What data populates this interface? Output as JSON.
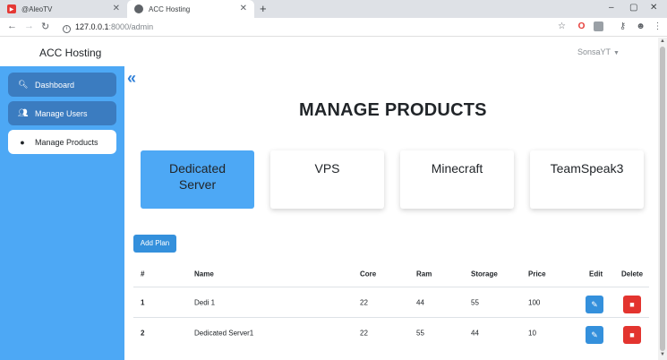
{
  "browser": {
    "tabs": [
      {
        "title": "@AleoTV",
        "icon": "youtube-studio-icon",
        "color": "#e53935"
      },
      {
        "title": "ACC Hosting",
        "icon": "globe-icon"
      }
    ],
    "url_host": "127.0.0.1",
    "url_path": ":8000/admin"
  },
  "navbar": {
    "brand": "ACC Hosting",
    "user": "SonsaYT"
  },
  "sidebar": {
    "items": [
      {
        "label": "Dashboard",
        "icon": "search-icon",
        "active": false
      },
      {
        "label": "Manage Users",
        "icon": "users-icon",
        "active": false
      },
      {
        "label": "Manage Products",
        "icon": "product-icon",
        "active": true
      }
    ]
  },
  "main": {
    "title": "MANAGE PRODUCTS",
    "categories": [
      {
        "label_line1": "Dedicated",
        "label_line2": "Server",
        "active": true
      },
      {
        "label_line1": "VPS",
        "label_line2": "",
        "active": false
      },
      {
        "label_line1": "Minecraft",
        "label_line2": "",
        "active": false
      },
      {
        "label_line1": "TeamSpeak3",
        "label_line2": "",
        "active": false
      }
    ],
    "add_button": "Add Plan",
    "table": {
      "headers": [
        "#",
        "Name",
        "Core",
        "Ram",
        "Storage",
        "Price",
        "Edit",
        "Delete"
      ],
      "rows": [
        {
          "id": "1",
          "name": "Dedi 1",
          "core": "22",
          "ram": "44",
          "storage": "55",
          "price": "100"
        },
        {
          "id": "2",
          "name": "Dedicated Server1",
          "core": "22",
          "ram": "55",
          "storage": "44",
          "price": "10"
        }
      ]
    }
  },
  "colors": {
    "sidebar_bg": "#4da8f5",
    "sidebar_item": "#3b7cc0",
    "primary": "#3490dc",
    "danger": "#e3342f"
  }
}
